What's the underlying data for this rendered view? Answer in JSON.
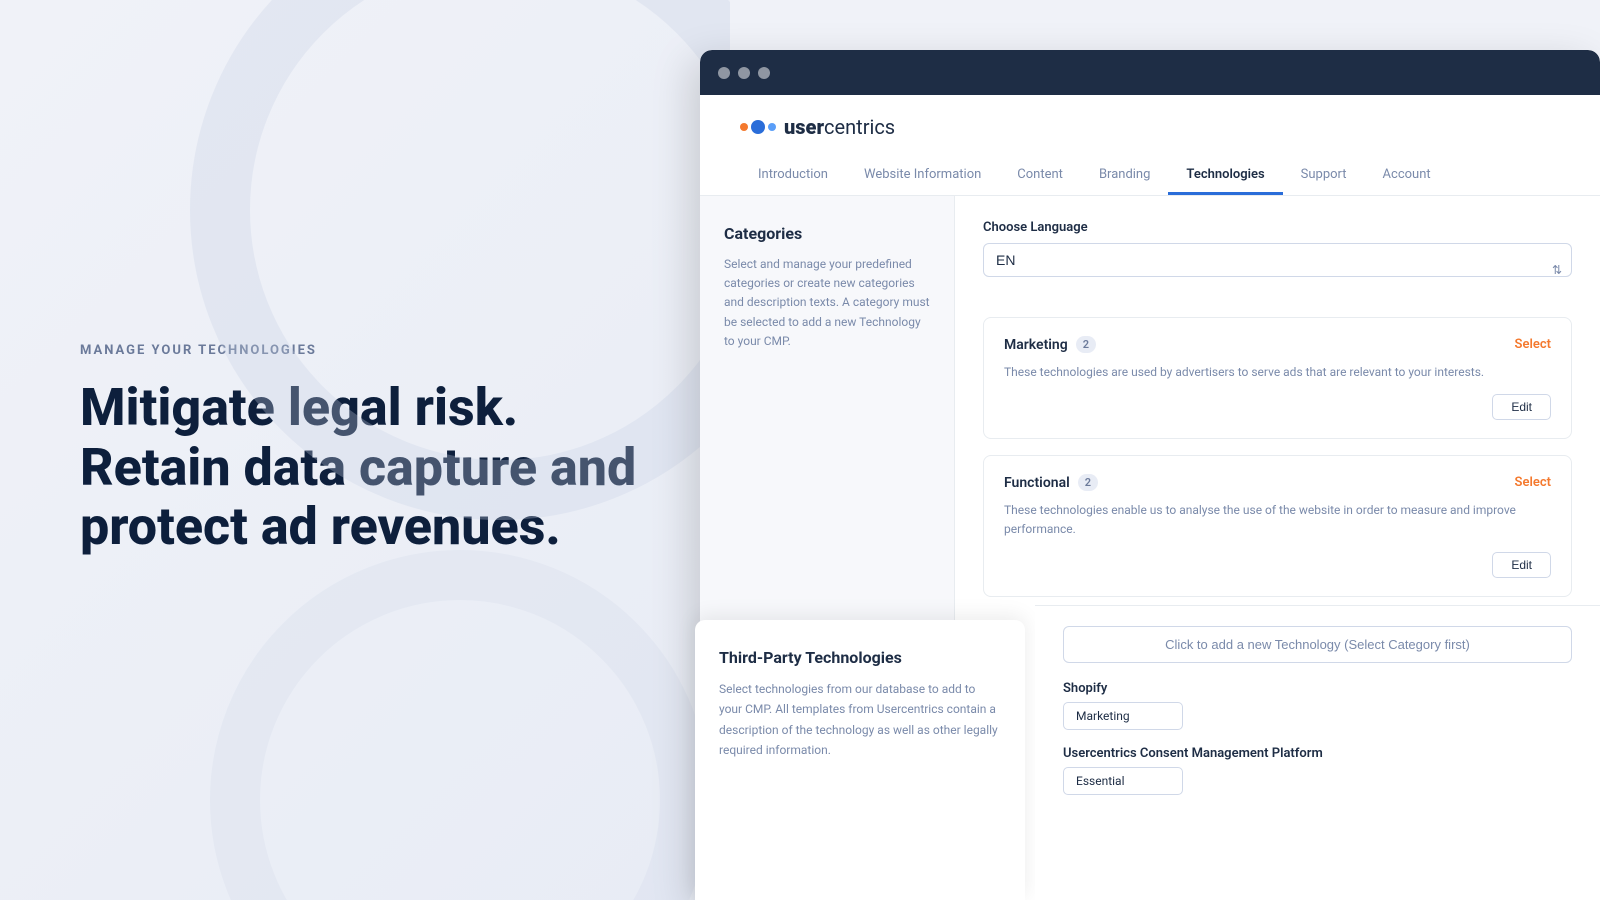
{
  "left": {
    "subtitle": "MANAGE YOUR TECHNOLOGIES",
    "heading": "Mitigate legal risk. Retain data capture and protect ad revenues."
  },
  "browser": {
    "dots": [
      "dot1",
      "dot2",
      "dot3"
    ],
    "logo": {
      "text_bold": "user",
      "text_light": "centrics"
    },
    "nav": {
      "tabs": [
        {
          "label": "Introduction",
          "active": false
        },
        {
          "label": "Website Information",
          "active": false
        },
        {
          "label": "Content",
          "active": false
        },
        {
          "label": "Branding",
          "active": false
        },
        {
          "label": "Technologies",
          "active": true
        },
        {
          "label": "Support",
          "active": false
        },
        {
          "label": "Account",
          "active": false
        }
      ]
    },
    "sidebar": {
      "title": "Categories",
      "description": "Select and manage your predefined categories or create new categories and description texts. A category must be selected to add a new Technology to your CMP."
    },
    "content": {
      "choose_language_label": "Choose Language",
      "language_value": "EN",
      "categories": [
        {
          "name": "Marketing",
          "count": 2,
          "select_label": "Select",
          "description": "These technologies are used by advertisers to serve ads that are relevant to your interests.",
          "edit_label": "Edit"
        },
        {
          "name": "Functional",
          "count": 2,
          "select_label": "Select",
          "description": "These technologies enable us to analyse the use of the website in order to measure and improve performance.",
          "edit_label": "Edit"
        }
      ]
    }
  },
  "lower_left": {
    "title": "Third-Party Technologies",
    "description": "Select technologies from our database to add to your CMP. All templates from Usercentrics contain a description of the technology as well as other legally required information."
  },
  "lower_right": {
    "add_tech_placeholder": "Click to add a new Technology (Select Category first)",
    "technologies": [
      {
        "name": "Shopify",
        "tag": "Marketing"
      },
      {
        "name": "Usercentrics Consent Management Platform",
        "tag": "Essential"
      }
    ]
  }
}
